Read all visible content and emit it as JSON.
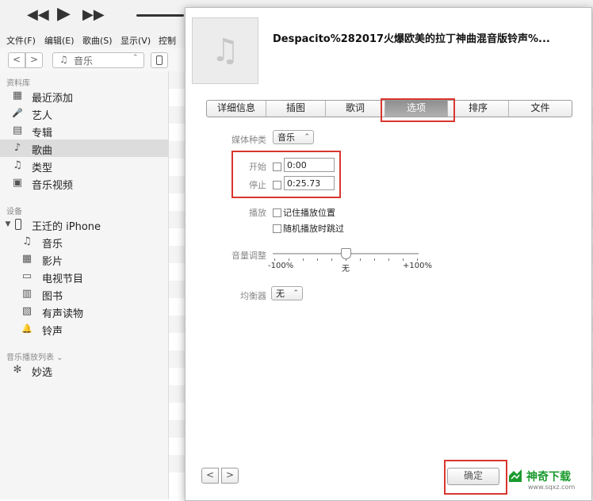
{
  "menubar": {
    "items": [
      "文件(F)",
      "编辑(E)",
      "歌曲(S)",
      "显示(V)",
      "控制"
    ]
  },
  "navbar": {
    "back": "<",
    "forward": ">",
    "source_label": "音乐",
    "source_icon": "music-note-icon"
  },
  "sidebar": {
    "library_section": "资料库",
    "library_items": [
      {
        "label": "最近添加",
        "icon": "grid-icon",
        "glyph": "▦"
      },
      {
        "label": "艺人",
        "icon": "microphone-icon",
        "glyph": "🎤"
      },
      {
        "label": "专辑",
        "icon": "album-icon",
        "glyph": "▤"
      },
      {
        "label": "歌曲",
        "icon": "music-note-icon",
        "glyph": "♪"
      },
      {
        "label": "类型",
        "icon": "genre-icon",
        "glyph": "♫"
      },
      {
        "label": "音乐视频",
        "icon": "music-video-icon",
        "glyph": "▣"
      }
    ],
    "selected_item": "歌曲",
    "devices_section": "设备",
    "device_name": "王迁的 iPhone",
    "device_items": [
      {
        "label": "音乐",
        "icon": "music-note-icon",
        "glyph": "♫"
      },
      {
        "label": "影片",
        "icon": "film-icon",
        "glyph": "▦"
      },
      {
        "label": "电视节目",
        "icon": "tv-icon",
        "glyph": "▭"
      },
      {
        "label": "图书",
        "icon": "book-icon",
        "glyph": "▥"
      },
      {
        "label": "有声读物",
        "icon": "audiobook-icon",
        "glyph": "▧"
      },
      {
        "label": "铃声",
        "icon": "bell-icon",
        "glyph": "🔔"
      }
    ],
    "playlists_section": "音乐播放列表 ⌄",
    "playlist_items": [
      {
        "label": "妙选",
        "icon": "genius-icon",
        "glyph": "✻"
      }
    ]
  },
  "dialog": {
    "title": "Despacito%282017火爆欧美的拉丁神曲混音版铃声%...",
    "artwork_icon": "music-note-icon",
    "tabs": [
      "详细信息",
      "插图",
      "歌词",
      "选项",
      "排序",
      "文件"
    ],
    "selected_tab": "选项",
    "media_kind_label": "媒体种类",
    "media_kind_value": "音乐",
    "start_label": "开始",
    "start_value": "0:00",
    "stop_label": "停止",
    "stop_value": "0:25.73",
    "playback_label": "播放",
    "remember_position": "记住播放位置",
    "skip_when_shuffling": "随机播放时跳过",
    "volume_label": "音量调整",
    "volume_min": "-100%",
    "volume_mid": "无",
    "volume_max": "+100%",
    "volume_level": 0,
    "eq_label": "均衡器",
    "eq_value": "无",
    "prev_button": "<",
    "next_button": ">",
    "ok_button": "确定"
  },
  "watermark": {
    "text": "神奇下载",
    "sub": "www.sqxz.com"
  },
  "colors": {
    "highlight_box": "#d9362f",
    "watermark_green": "#1b9a2e"
  }
}
